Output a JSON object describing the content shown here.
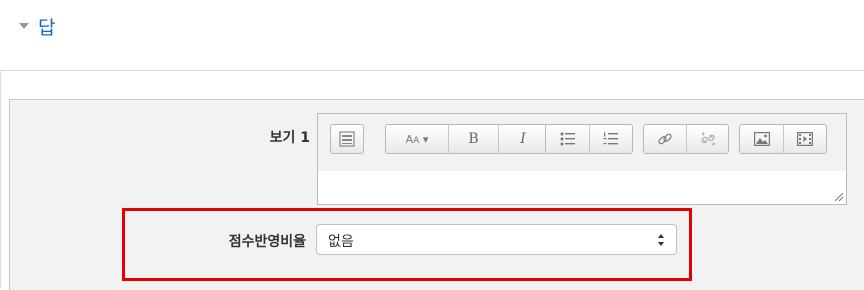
{
  "section": {
    "title": "답",
    "collapse_icon": "chevron-down-icon"
  },
  "choice": {
    "label": "보기 1",
    "toolbar": {
      "buttons": [
        "toolbar-toggle-icon",
        "font-style-icon",
        "bold-icon",
        "italic-icon",
        "unordered-list-icon",
        "ordered-list-icon",
        "link-icon",
        "unlink-icon",
        "image-icon",
        "media-icon"
      ],
      "bold": "B",
      "italic": "I",
      "font_style": "A"
    }
  },
  "grade": {
    "label": "점수반영비율",
    "selected": "없음"
  },
  "colors": {
    "highlight": "#e30000",
    "link": "#0f6cbf"
  }
}
